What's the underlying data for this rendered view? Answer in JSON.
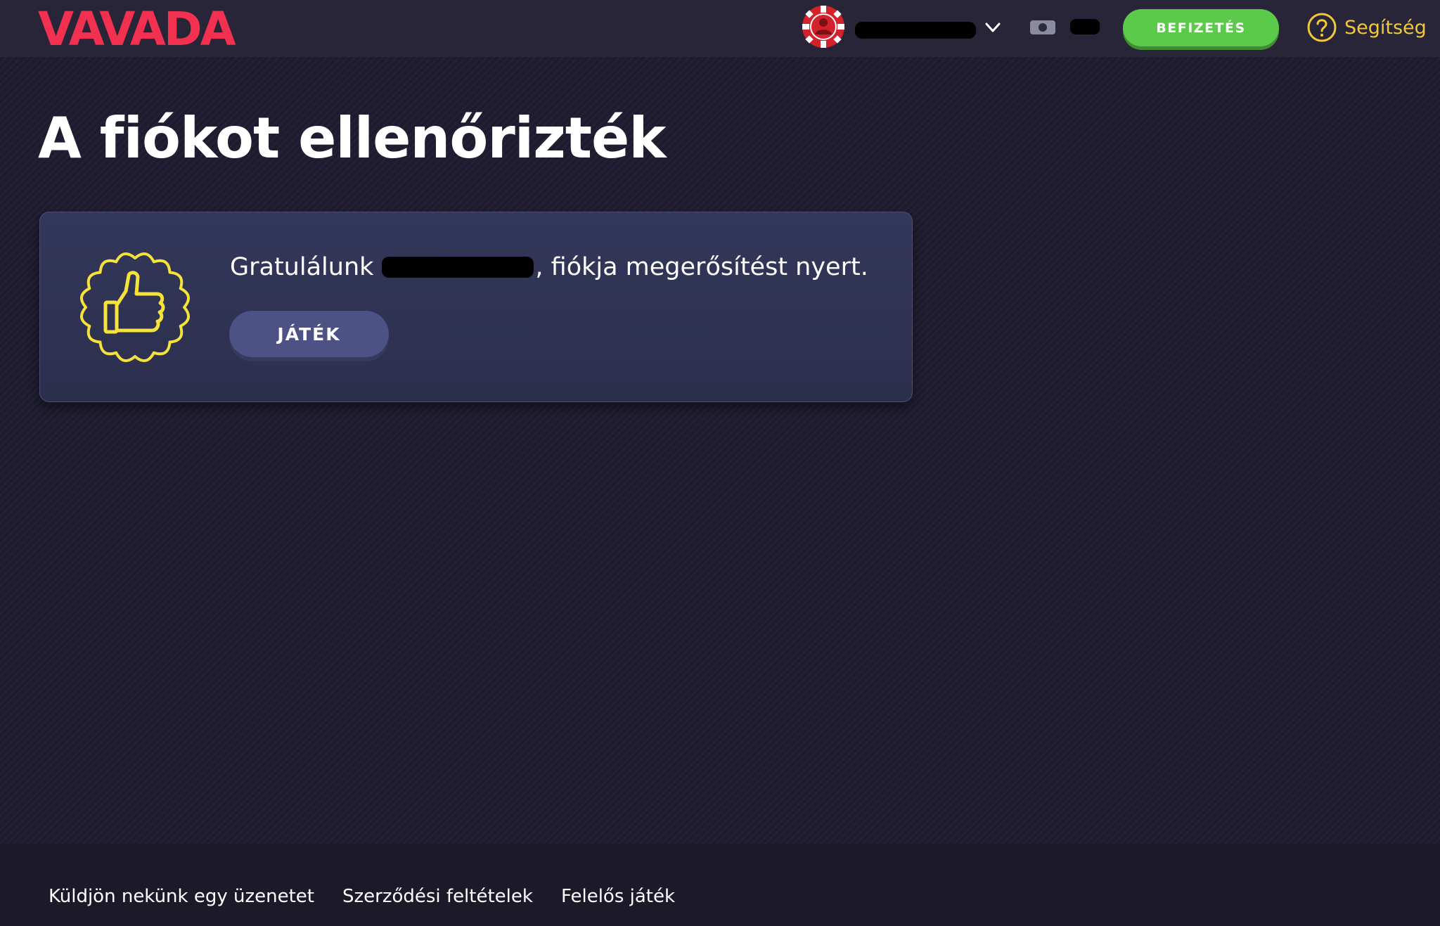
{
  "header": {
    "logo_text": "VAVADA",
    "deposit_label": "BEFIZETÉS",
    "help_label": "Segítség"
  },
  "main": {
    "title": "A fiókot ellenőrizték",
    "card": {
      "message_prefix": "Gratulálunk",
      "message_suffix": ", fiókja megerősítést nyert.",
      "play_label": "JÁTÉK"
    }
  },
  "footer": {
    "links": [
      "Küldjön nekünk egy üzenetet",
      "Szerződési feltételek",
      "Felelős játék"
    ]
  },
  "colors": {
    "brand": "#f2304f",
    "deposit": "#5bc94a",
    "accent_yellow": "#f1c83a",
    "background": "#1f1c31"
  },
  "icons": [
    "vavada-logo",
    "avatar-chip-icon",
    "chevron-down-icon",
    "cash-icon",
    "help-circle-icon",
    "thumbs-up-badge-icon"
  ]
}
